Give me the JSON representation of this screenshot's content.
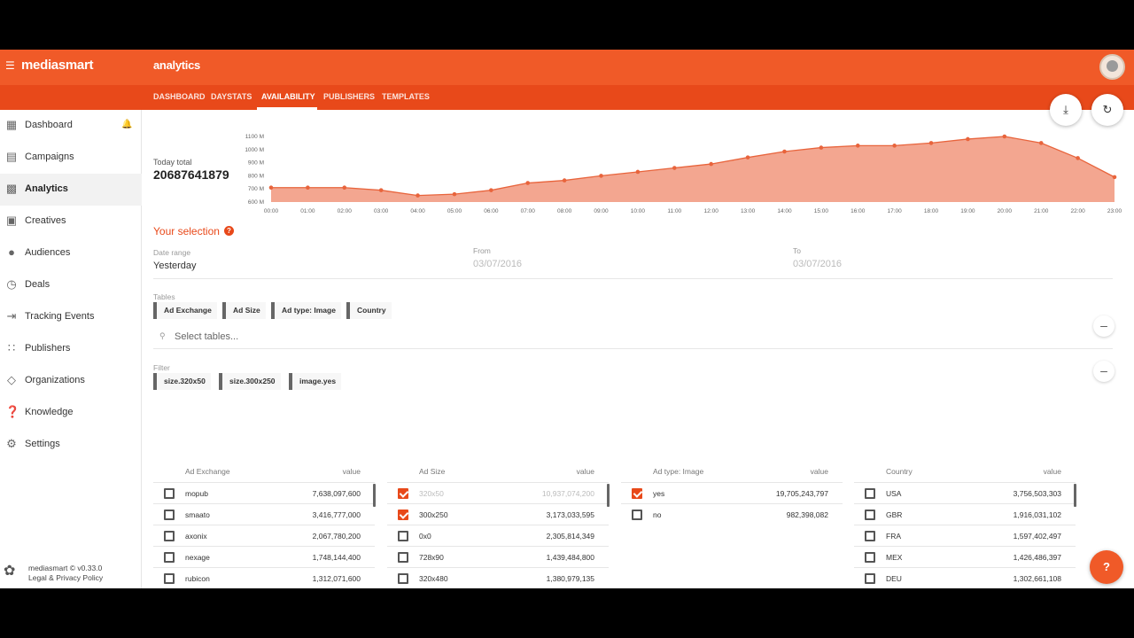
{
  "header": {
    "brand": "mediasmart",
    "section": "analytics"
  },
  "tabs": [
    "DASHBOARD",
    "DAYSTATS",
    "AVAILABILITY",
    "PUBLISHERS",
    "TEMPLATES"
  ],
  "sidebar": {
    "items": [
      {
        "label": "Dashboard",
        "icon": "dashboard-icon"
      },
      {
        "label": "Campaigns",
        "icon": "campaigns-icon"
      },
      {
        "label": "Analytics",
        "icon": "analytics-icon"
      },
      {
        "label": "Creatives",
        "icon": "creatives-icon"
      },
      {
        "label": "Audiences",
        "icon": "audiences-icon"
      },
      {
        "label": "Deals",
        "icon": "deals-icon"
      },
      {
        "label": "Tracking Events",
        "icon": "tracking-icon"
      },
      {
        "label": "Publishers",
        "icon": "publishers-icon"
      },
      {
        "label": "Organizations",
        "icon": "organizations-icon"
      },
      {
        "label": "Knowledge",
        "icon": "knowledge-icon"
      },
      {
        "label": "Settings",
        "icon": "settings-icon"
      }
    ],
    "footer_line1": "mediasmart © v0.33.0",
    "footer_line2": "Legal & Privacy Policy"
  },
  "today": {
    "label": "Today total",
    "value": "20687641879"
  },
  "chart_data": {
    "type": "area",
    "x": [
      "00:00",
      "01:00",
      "02:00",
      "03:00",
      "04:00",
      "05:00",
      "06:00",
      "07:00",
      "08:00",
      "09:00",
      "10:00",
      "11:00",
      "12:00",
      "13:00",
      "14:00",
      "15:00",
      "16:00",
      "17:00",
      "18:00",
      "19:00",
      "20:00",
      "21:00",
      "22:00",
      "23:00"
    ],
    "values": [
      710,
      710,
      710,
      690,
      650,
      660,
      690,
      745,
      765,
      800,
      830,
      860,
      890,
      940,
      985,
      1015,
      1030,
      1030,
      1050,
      1080,
      1100,
      1050,
      935,
      790
    ],
    "yticks": [
      "600 M",
      "700 M",
      "800 M",
      "900 M",
      "1000 M",
      "1100 M"
    ],
    "ylim": [
      600,
      1100
    ],
    "color": "#e8643c",
    "fill": "#f3a690"
  },
  "selection": {
    "title": "Your selection",
    "date_range_label": "Date range",
    "date_range_value": "Yesterday",
    "from_label": "From",
    "from_value": "03/07/2016",
    "to_label": "To",
    "to_value": "03/07/2016",
    "tables_label": "Tables",
    "tables": [
      "Ad Exchange",
      "Ad Size",
      "Ad type: Image",
      "Country"
    ],
    "select_placeholder": "Select tables...",
    "filter_label": "Filter",
    "filters": [
      "size.320x50",
      "size.300x250",
      "image.yes"
    ]
  },
  "tables": [
    {
      "header": "Ad Exchange",
      "value_header": "value",
      "rows": [
        {
          "name": "mopub",
          "value": "7,638,097,600",
          "checked": false
        },
        {
          "name": "smaato",
          "value": "3,416,777,000",
          "checked": false
        },
        {
          "name": "axonix",
          "value": "2,067,780,200",
          "checked": false
        },
        {
          "name": "nexage",
          "value": "1,748,144,400",
          "checked": false
        },
        {
          "name": "rubicon",
          "value": "1,312,071,600",
          "checked": false
        }
      ]
    },
    {
      "header": "Ad Size",
      "value_header": "value",
      "rows": [
        {
          "name": "320x50",
          "value": "10,937,074,200",
          "checked": true,
          "muted": true
        },
        {
          "name": "300x250",
          "value": "3,173,033,595",
          "checked": true
        },
        {
          "name": "0x0",
          "value": "2,305,814,349",
          "checked": false
        },
        {
          "name": "728x90",
          "value": "1,439,484,800",
          "checked": false
        },
        {
          "name": "320x480",
          "value": "1,380,979,135",
          "checked": false
        }
      ]
    },
    {
      "header": "Ad type: Image",
      "value_header": "value",
      "rows": [
        {
          "name": "yes",
          "value": "19,705,243,797",
          "checked": true
        },
        {
          "name": "no",
          "value": "982,398,082",
          "checked": false
        }
      ]
    },
    {
      "header": "Country",
      "value_header": "value",
      "rows": [
        {
          "name": "USA",
          "value": "3,756,503,303",
          "checked": false
        },
        {
          "name": "GBR",
          "value": "1,916,031,102",
          "checked": false
        },
        {
          "name": "FRA",
          "value": "1,597,402,497",
          "checked": false
        },
        {
          "name": "MEX",
          "value": "1,426,486,397",
          "checked": false
        },
        {
          "name": "DEU",
          "value": "1,302,661,108",
          "checked": false
        }
      ]
    }
  ]
}
